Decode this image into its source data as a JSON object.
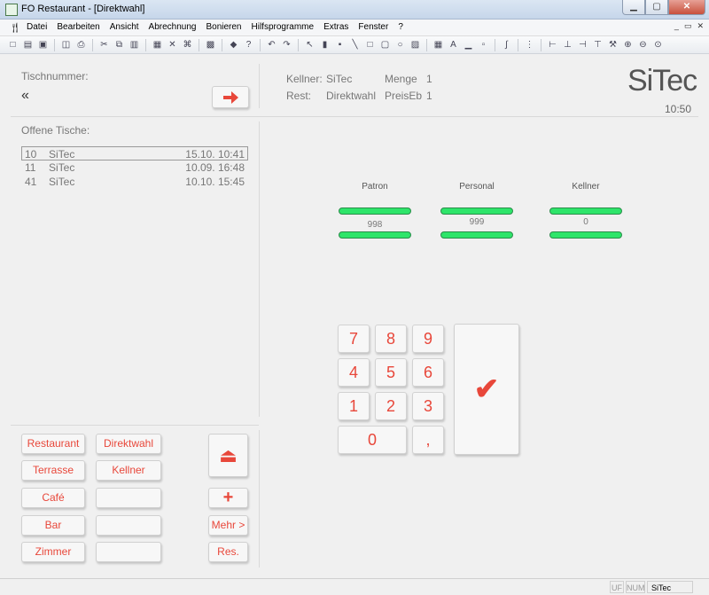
{
  "window": {
    "title": "FO Restaurant - [Direktwahl]"
  },
  "menu": [
    "Datei",
    "Bearbeiten",
    "Ansicht",
    "Abrechnung",
    "Bonieren",
    "Hilfsprogramme",
    "Extras",
    "Fenster",
    "?"
  ],
  "header": {
    "table_number_label": "Tischnummer:",
    "table_number_value": "«",
    "waiter_label": "Kellner:",
    "waiter_value": "SiTec",
    "rest_label": "Rest:",
    "rest_value": "Direktwahl",
    "quantity_label": "Menge",
    "quantity_value": "1",
    "unit_price_label": "PreisEb",
    "unit_price_value": "1",
    "logo_text": "SiTec",
    "time": "10:50"
  },
  "open_tables": {
    "label": "Offene Tische:",
    "rows": [
      {
        "number": "10",
        "waiter": "SiTec",
        "datetime": "15.10. 10:41"
      },
      {
        "number": "11",
        "waiter": "SiTec",
        "datetime": "10.09. 16:48"
      },
      {
        "number": "41",
        "waiter": "SiTec",
        "datetime": "10.10. 15:45"
      }
    ]
  },
  "stats": [
    {
      "label": "Patron",
      "value": "998"
    },
    {
      "label": "Personal",
      "value": "999"
    },
    {
      "label": "Kellner",
      "value": "0"
    }
  ],
  "area_buttons": {
    "left": [
      "Restaurant",
      "Terrasse",
      "Café",
      "Bar",
      "Zimmer"
    ],
    "right": [
      "Direktwahl",
      "Kellner",
      "",
      "",
      ""
    ]
  },
  "action_buttons": {
    "eject": "⏏",
    "plus": "+",
    "more": "Mehr >",
    "res": "Res."
  },
  "keypad": {
    "keys": [
      "7",
      "8",
      "9",
      "4",
      "5",
      "6",
      "1",
      "2",
      "3",
      "0",
      ","
    ],
    "confirm": "✔"
  },
  "statusbar": {
    "uf": "UF",
    "num": "NUM",
    "user": "SiTec"
  },
  "colors": {
    "accent": "#e8473a",
    "bar": "#2ee56a"
  }
}
